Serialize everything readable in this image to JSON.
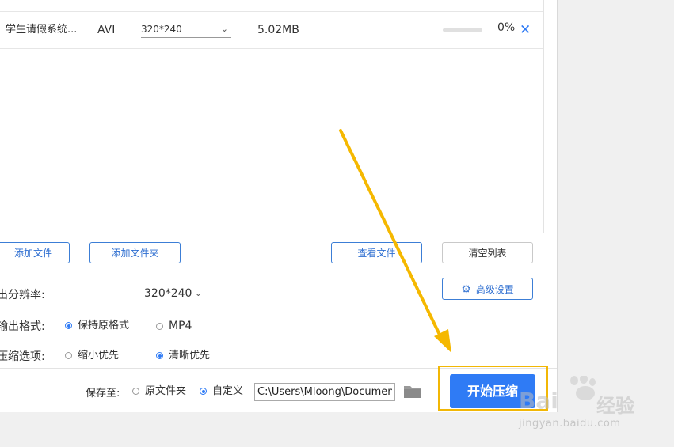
{
  "file_list": {
    "rows": [
      {
        "name": "学生请假系统...",
        "format": "AVI",
        "resolution": "320*240",
        "size": "5.02MB",
        "progress_percent": 0,
        "progress_label": "0%",
        "remove_icon": "close-icon"
      }
    ]
  },
  "buttons": {
    "add_file": "添加文件",
    "add_folder": "添加文件夹",
    "view_file": "查看文件",
    "clear_list": "清空列表",
    "advanced": "高级设置",
    "start": "开始压缩"
  },
  "settings": {
    "resolution_label": "出分辨率:",
    "resolution_value": "320*240",
    "format_label": "输出格式:",
    "format_options": [
      {
        "label": "保持原格式",
        "selected": true
      },
      {
        "label": "MP4",
        "selected": false
      }
    ],
    "compress_label": "压缩选项:",
    "compress_options": [
      {
        "label": "缩小优先",
        "selected": false
      },
      {
        "label": "清晰优先",
        "selected": true
      }
    ]
  },
  "save": {
    "label": "保存至:",
    "options": [
      {
        "label": "原文件夹",
        "selected": false
      },
      {
        "label": "自定义",
        "selected": true
      }
    ],
    "path": "C:\\Users\\Mloong\\Documents",
    "folder_icon": "folder-icon"
  },
  "watermark": {
    "brand": "Bai",
    "brand_cn": "经验",
    "url": "jingyan.baidu.com"
  },
  "colors": {
    "accent": "#2f7bf5",
    "highlight": "#f2b705"
  }
}
